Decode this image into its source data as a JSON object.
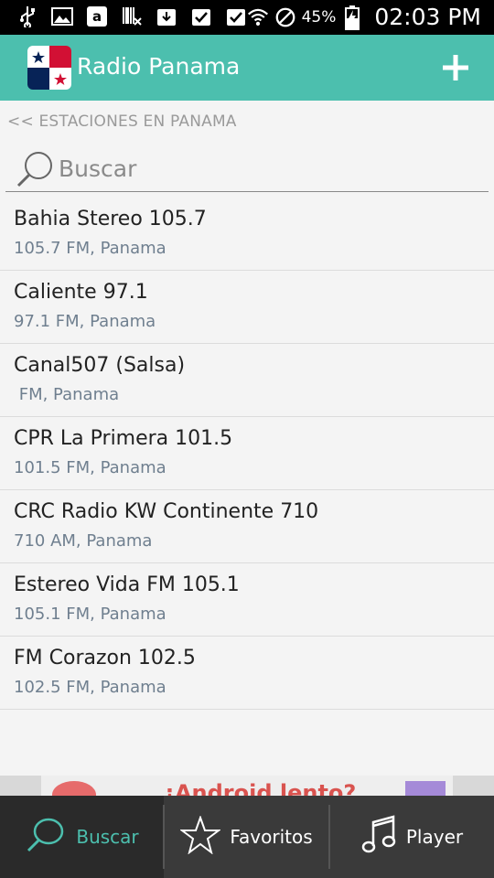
{
  "status_bar": {
    "battery_percent": "45%",
    "time": "02:03 PM",
    "icons": [
      "usb-icon",
      "image-icon",
      "amazon-icon",
      "barcode-icon",
      "download-icon",
      "download-check-icon",
      "check-icon",
      "wifi-icon",
      "do-not-disturb-icon",
      "battery-icon"
    ]
  },
  "app_bar": {
    "title": "Radio Panama",
    "add_icon": "plus-icon",
    "logo": "panama-flag-icon"
  },
  "breadcrumb": "<< ESTACIONES EN PANAMA",
  "search": {
    "placeholder": "Buscar",
    "value": ""
  },
  "stations": [
    {
      "name": "Bahia Stereo 105.7",
      "sub": "105.7 FM, Panama"
    },
    {
      "name": "Caliente 97.1",
      "sub": "97.1 FM, Panama"
    },
    {
      "name": "Canal507 (Salsa)",
      "sub": " FM, Panama"
    },
    {
      "name": "CPR La Primera 101.5",
      "sub": "101.5 FM, Panama"
    },
    {
      "name": "CRC Radio KW Continente 710",
      "sub": "710 AM, Panama"
    },
    {
      "name": "Estereo Vida FM 105.1",
      "sub": "105.1 FM, Panama"
    },
    {
      "name": "FM Corazon 102.5",
      "sub": "102.5 FM, Panama"
    }
  ],
  "ad": {
    "text": "¡Android lento?"
  },
  "bottom_nav": {
    "items": [
      {
        "label": "Buscar",
        "icon": "search-icon",
        "active": true
      },
      {
        "label": "Favoritos",
        "icon": "star-icon",
        "active": false
      },
      {
        "label": "Player",
        "icon": "music-note-icon",
        "active": false
      }
    ]
  },
  "colors": {
    "accent": "#4cbfae",
    "status_bar": "#000000",
    "nav_bg": "#3a3a3a",
    "list_bg": "#f4f4f4"
  }
}
